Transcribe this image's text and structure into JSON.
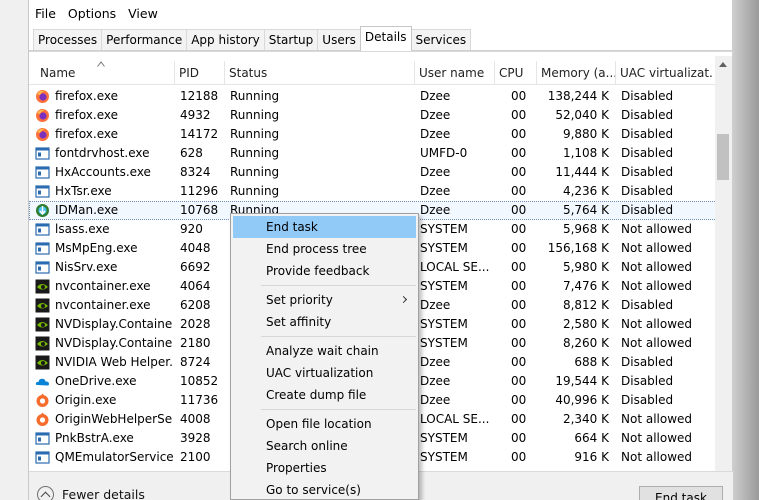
{
  "menubar": {
    "file": "File",
    "options": "Options",
    "view": "View"
  },
  "tabs": [
    "Processes",
    "Performance",
    "App history",
    "Startup",
    "Users",
    "Details",
    "Services"
  ],
  "active_tab": "Details",
  "columns": {
    "name": "Name",
    "pid": "PID",
    "status": "Status",
    "user": "User name",
    "cpu": "CPU",
    "memory": "Memory (a...",
    "uac": "UAC virtualizat..."
  },
  "rows": [
    {
      "name": "firefox.exe",
      "icon": "firefox-icon",
      "pid": "12188",
      "status": "Running",
      "user": "Dzee",
      "cpu": "00",
      "memory": "138,244 K",
      "uac": "Disabled"
    },
    {
      "name": "firefox.exe",
      "icon": "firefox-icon",
      "pid": "4932",
      "status": "Running",
      "user": "Dzee",
      "cpu": "00",
      "memory": "52,040 K",
      "uac": "Disabled"
    },
    {
      "name": "firefox.exe",
      "icon": "firefox-icon",
      "pid": "14172",
      "status": "Running",
      "user": "Dzee",
      "cpu": "00",
      "memory": "9,880 K",
      "uac": "Disabled"
    },
    {
      "name": "fontdrvhost.exe",
      "icon": "app-window-icon",
      "pid": "628",
      "status": "Running",
      "user": "UMFD-0",
      "cpu": "00",
      "memory": "1,108 K",
      "uac": "Disabled"
    },
    {
      "name": "HxAccounts.exe",
      "icon": "app-window-icon",
      "pid": "8324",
      "status": "Running",
      "user": "Dzee",
      "cpu": "00",
      "memory": "11,444 K",
      "uac": "Disabled"
    },
    {
      "name": "HxTsr.exe",
      "icon": "app-window-icon",
      "pid": "11296",
      "status": "Running",
      "user": "Dzee",
      "cpu": "00",
      "memory": "4,236 K",
      "uac": "Disabled"
    },
    {
      "name": "IDMan.exe",
      "icon": "idm-icon",
      "pid": "10768",
      "status": "Running",
      "user": "Dzee",
      "cpu": "00",
      "memory": "5,764 K",
      "uac": "Disabled",
      "selected": true
    },
    {
      "name": "lsass.exe",
      "icon": "app-window-icon",
      "pid": "920",
      "status": "",
      "user": "SYSTEM",
      "cpu": "00",
      "memory": "5,968 K",
      "uac": "Not allowed"
    },
    {
      "name": "MsMpEng.exe",
      "icon": "app-window-icon",
      "pid": "4048",
      "status": "",
      "user": "SYSTEM",
      "cpu": "00",
      "memory": "156,168 K",
      "uac": "Not allowed"
    },
    {
      "name": "NisSrv.exe",
      "icon": "app-window-icon",
      "pid": "6692",
      "status": "",
      "user": "LOCAL SE...",
      "cpu": "00",
      "memory": "5,980 K",
      "uac": "Not allowed"
    },
    {
      "name": "nvcontainer.exe",
      "icon": "nvidia-icon",
      "pid": "4064",
      "status": "",
      "user": "SYSTEM",
      "cpu": "00",
      "memory": "7,476 K",
      "uac": "Not allowed"
    },
    {
      "name": "nvcontainer.exe",
      "icon": "nvidia-icon",
      "pid": "6208",
      "status": "",
      "user": "Dzee",
      "cpu": "00",
      "memory": "8,812 K",
      "uac": "Disabled"
    },
    {
      "name": "NVDisplay.Container...",
      "icon": "nvidia-icon",
      "pid": "2028",
      "status": "",
      "user": "SYSTEM",
      "cpu": "00",
      "memory": "2,580 K",
      "uac": "Not allowed"
    },
    {
      "name": "NVDisplay.Container...",
      "icon": "nvidia-icon",
      "pid": "2180",
      "status": "",
      "user": "SYSTEM",
      "cpu": "00",
      "memory": "8,260 K",
      "uac": "Not allowed"
    },
    {
      "name": "NVIDIA Web Helper....",
      "icon": "nvidia-icon",
      "pid": "8724",
      "status": "",
      "user": "Dzee",
      "cpu": "00",
      "memory": "688 K",
      "uac": "Disabled"
    },
    {
      "name": "OneDrive.exe",
      "icon": "onedrive-icon",
      "pid": "10852",
      "status": "",
      "user": "Dzee",
      "cpu": "00",
      "memory": "19,544 K",
      "uac": "Disabled"
    },
    {
      "name": "Origin.exe",
      "icon": "origin-icon",
      "pid": "11736",
      "status": "",
      "user": "Dzee",
      "cpu": "00",
      "memory": "40,996 K",
      "uac": "Disabled"
    },
    {
      "name": "OriginWebHelperSer...",
      "icon": "origin-icon",
      "pid": "4008",
      "status": "",
      "user": "LOCAL SE...",
      "cpu": "00",
      "memory": "2,340 K",
      "uac": "Not allowed"
    },
    {
      "name": "PnkBstrA.exe",
      "icon": "app-window-icon",
      "pid": "3928",
      "status": "",
      "user": "SYSTEM",
      "cpu": "00",
      "memory": "664 K",
      "uac": "Not allowed"
    },
    {
      "name": "QMEmulatorService....",
      "icon": "app-window-icon",
      "pid": "2100",
      "status": "",
      "user": "SYSTEM",
      "cpu": "00",
      "memory": "916 K",
      "uac": "Not allowed"
    }
  ],
  "context_menu": {
    "items": [
      {
        "label": "End task",
        "highlighted": true
      },
      {
        "label": "End process tree"
      },
      {
        "label": "Provide feedback"
      },
      {
        "label": "Set priority",
        "submenu": true
      },
      {
        "label": "Set affinity"
      },
      {
        "label": "Analyze wait chain"
      },
      {
        "label": "UAC virtualization"
      },
      {
        "label": "Create dump file"
      },
      {
        "label": "Open file location"
      },
      {
        "label": "Search online"
      },
      {
        "label": "Properties"
      },
      {
        "label": "Go to service(s)"
      }
    ]
  },
  "footer": {
    "fewer_details": "Fewer details",
    "end_task": "End task"
  },
  "colors": {
    "highlight": "#91c9f7",
    "selection_row": "#f2f8ff",
    "firefox": "#ff7139",
    "origin": "#f56c2d",
    "nvidia": "#76b900",
    "onedrive": "#0a84d6",
    "app_icon": "#2b6cb0"
  }
}
